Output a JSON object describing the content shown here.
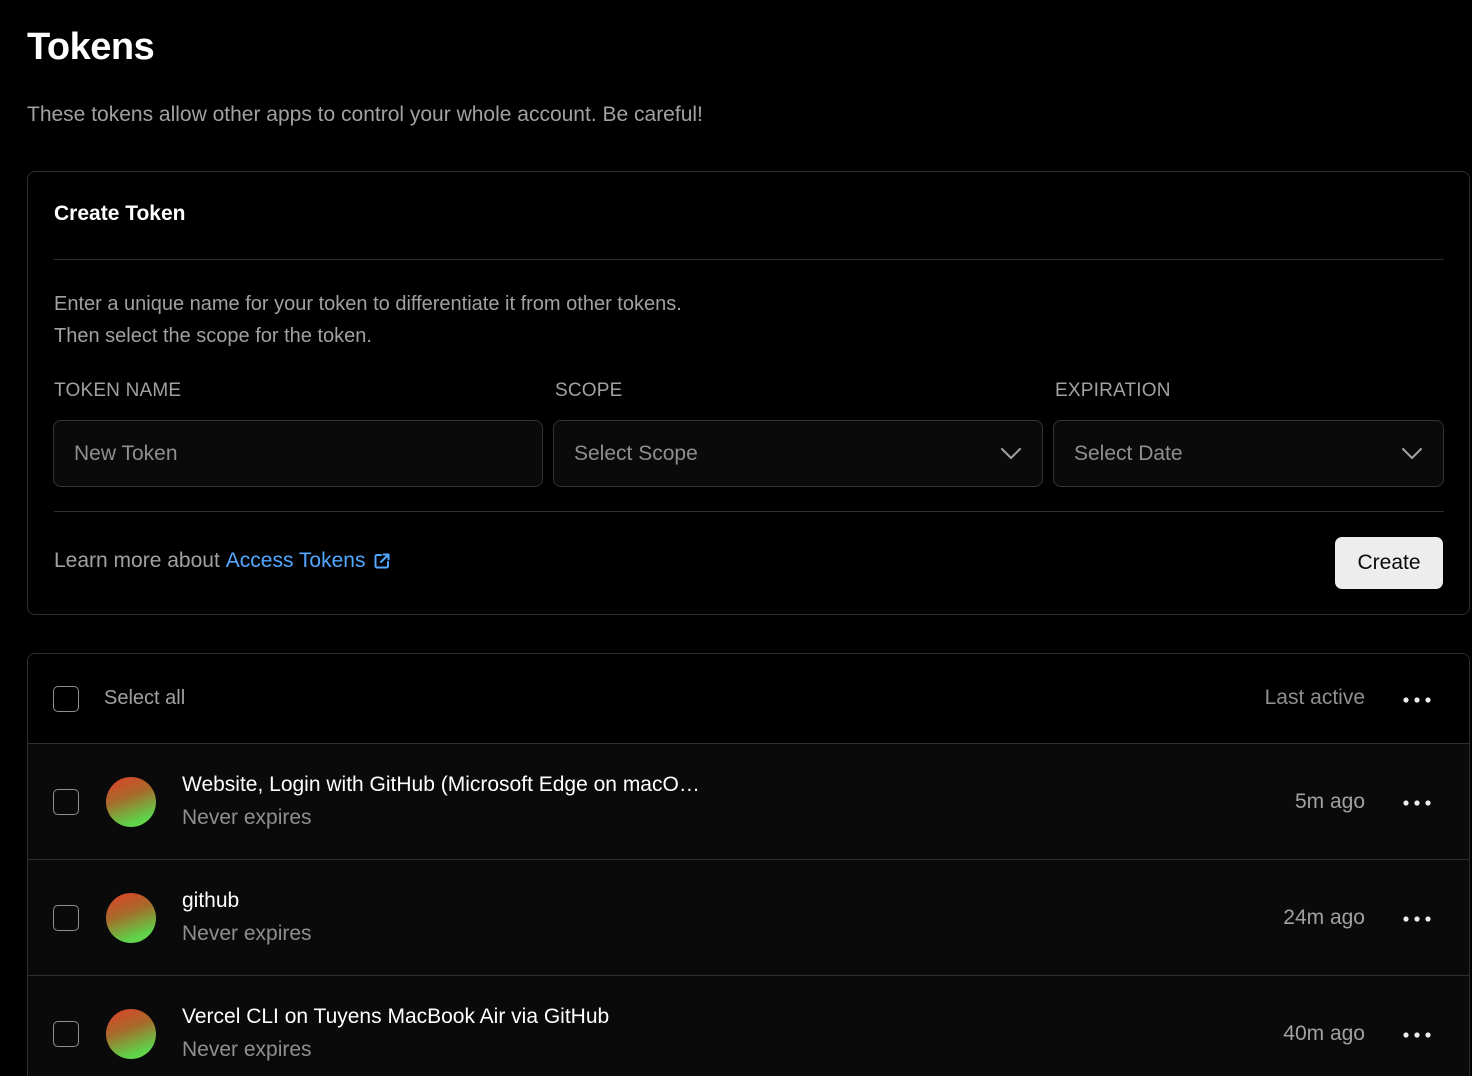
{
  "page": {
    "title": "Tokens",
    "subtitle": "These tokens allow other apps to control your whole account. Be careful!"
  },
  "create_card": {
    "title": "Create Token",
    "description_line1": "Enter a unique name for your token to differentiate it from other tokens.",
    "description_line2": "Then select the scope for the token.",
    "token_name": {
      "label": "TOKEN NAME",
      "placeholder": "New Token",
      "value": ""
    },
    "scope": {
      "label": "SCOPE",
      "value": "Select Scope"
    },
    "expiration": {
      "label": "EXPIRATION",
      "value": "Select Date"
    },
    "learn_prefix": "Learn more about",
    "learn_link": "Access Tokens",
    "create_label": "Create"
  },
  "list": {
    "select_all_label": "Select all",
    "last_active_label": "Last active",
    "rows": [
      {
        "name": "Website, Login with GitHub (Microsoft Edge on macO…",
        "expires": "Never expires",
        "last_active": "5m ago"
      },
      {
        "name": "github",
        "expires": "Never expires",
        "last_active": "24m ago"
      },
      {
        "name": "Vercel CLI on Tuyens MacBook Air via GitHub",
        "expires": "Never expires",
        "last_active": "40m ago"
      }
    ]
  },
  "colors": {
    "background": "#000000",
    "link": "#52a8ff",
    "button_bg": "#ededed",
    "avatar_gradient": [
      "#e0402a",
      "#5fd048"
    ]
  },
  "icons": [
    "chevron-down-icon",
    "external-link-icon",
    "more-horizontal-icon"
  ]
}
